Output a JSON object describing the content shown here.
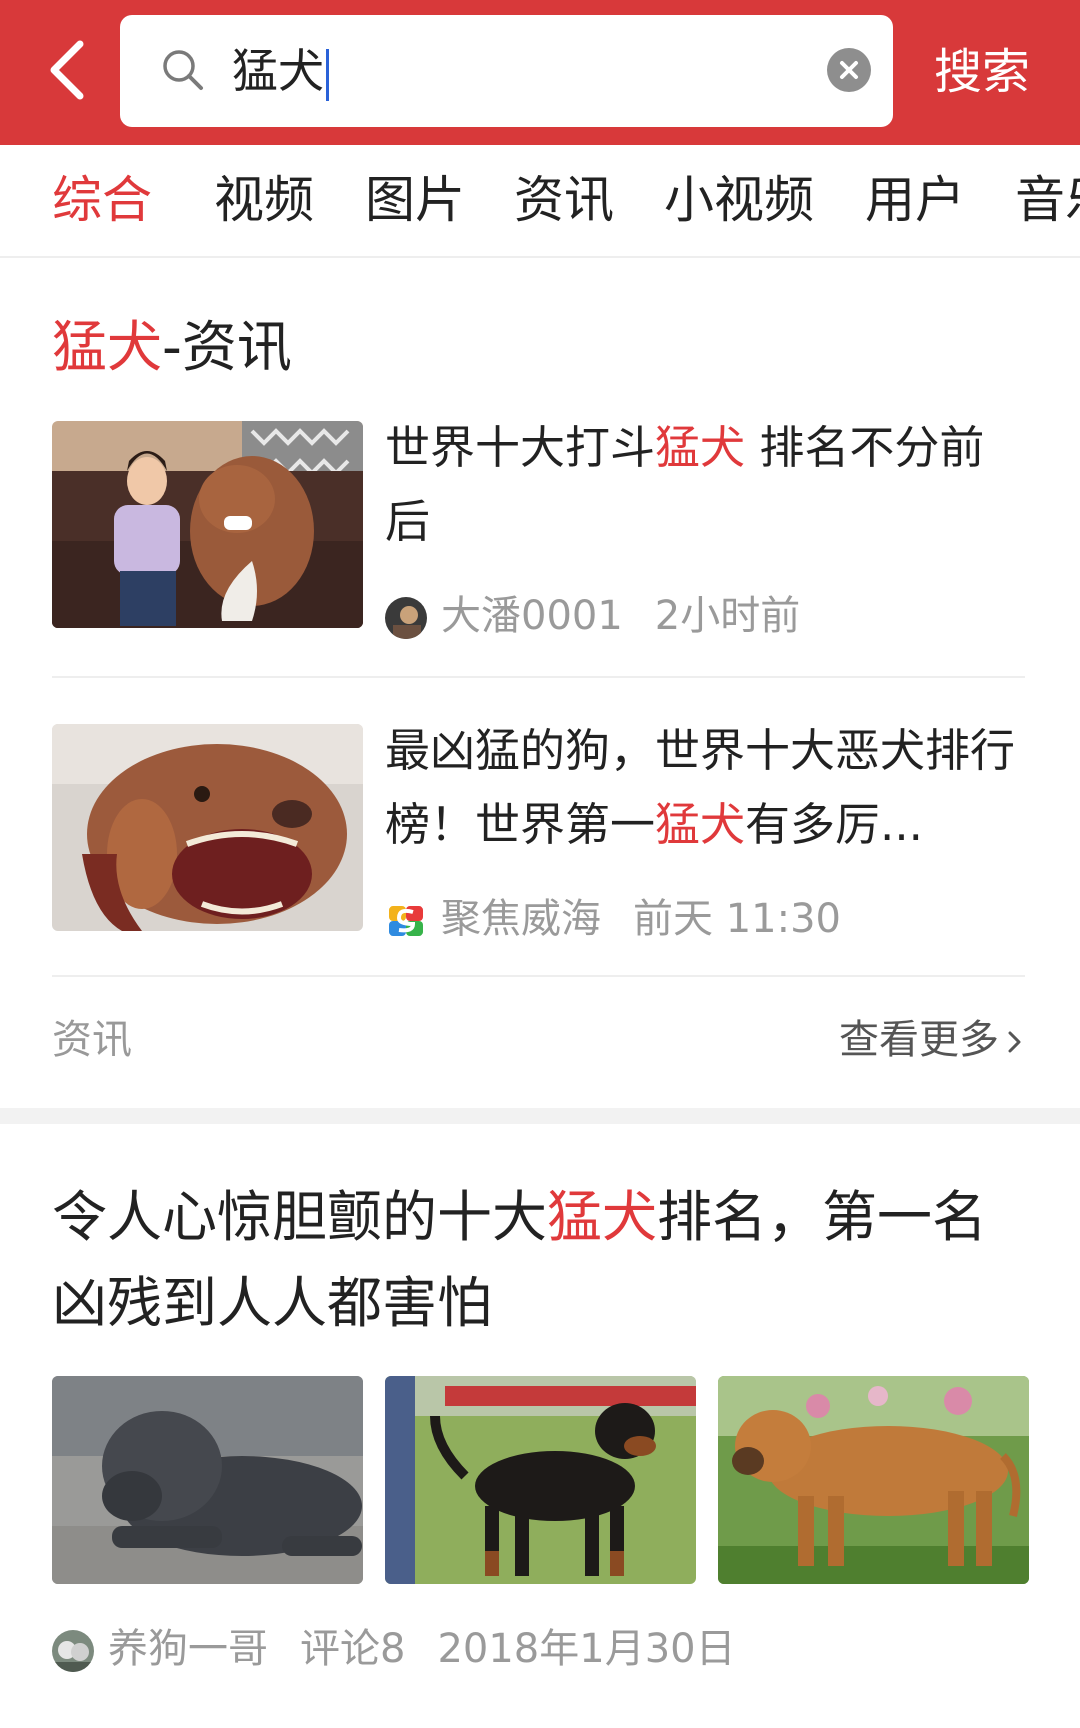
{
  "search": {
    "query": "猛犬",
    "button_label": "搜索"
  },
  "tabs": [
    {
      "label": "综合",
      "active": true
    },
    {
      "label": "视频"
    },
    {
      "label": "图片"
    },
    {
      "label": "资讯"
    },
    {
      "label": "小视频"
    },
    {
      "label": "用户"
    },
    {
      "label": "音乐"
    }
  ],
  "news_section": {
    "title_highlight": "猛犬",
    "title_rest": "-资讯",
    "items": [
      {
        "title_before": "世界十大打斗",
        "title_highlight": "猛犬",
        "title_after": " 排名不分前后",
        "author": "大潘0001",
        "time": "2小时前",
        "image": "woman-with-brown-pitbull-on-sofa"
      },
      {
        "title_before": "最凶猛的狗，世界十大恶犬排行榜！世界第一",
        "title_highlight": "猛犬",
        "title_after": "有多厉...",
        "author": "聚焦威海",
        "time": "前天 11:30",
        "image": "snarling-pitbull-closeup"
      }
    ],
    "footer_label": "资讯",
    "more_label": "查看更多"
  },
  "article": {
    "title_before": "令人心惊胆颤的十大",
    "title_highlight": "猛犬",
    "title_after": "排名，第一名凶残到人人都害怕",
    "images": [
      "black-mastiff-lying",
      "rottweiler-on-grass",
      "tan-mastiff-in-garden"
    ],
    "author": "养狗一哥",
    "comments": "评论8",
    "date": "2018年1月30日"
  },
  "colors": {
    "header_red": "#d8393a",
    "highlight_red": "#e0393b",
    "meta_gray": "#9a9a9a"
  },
  "icons": {
    "back": "back-arrow-icon",
    "search": "search-icon",
    "clear": "clear-icon",
    "more": "chevron-right-icon"
  }
}
